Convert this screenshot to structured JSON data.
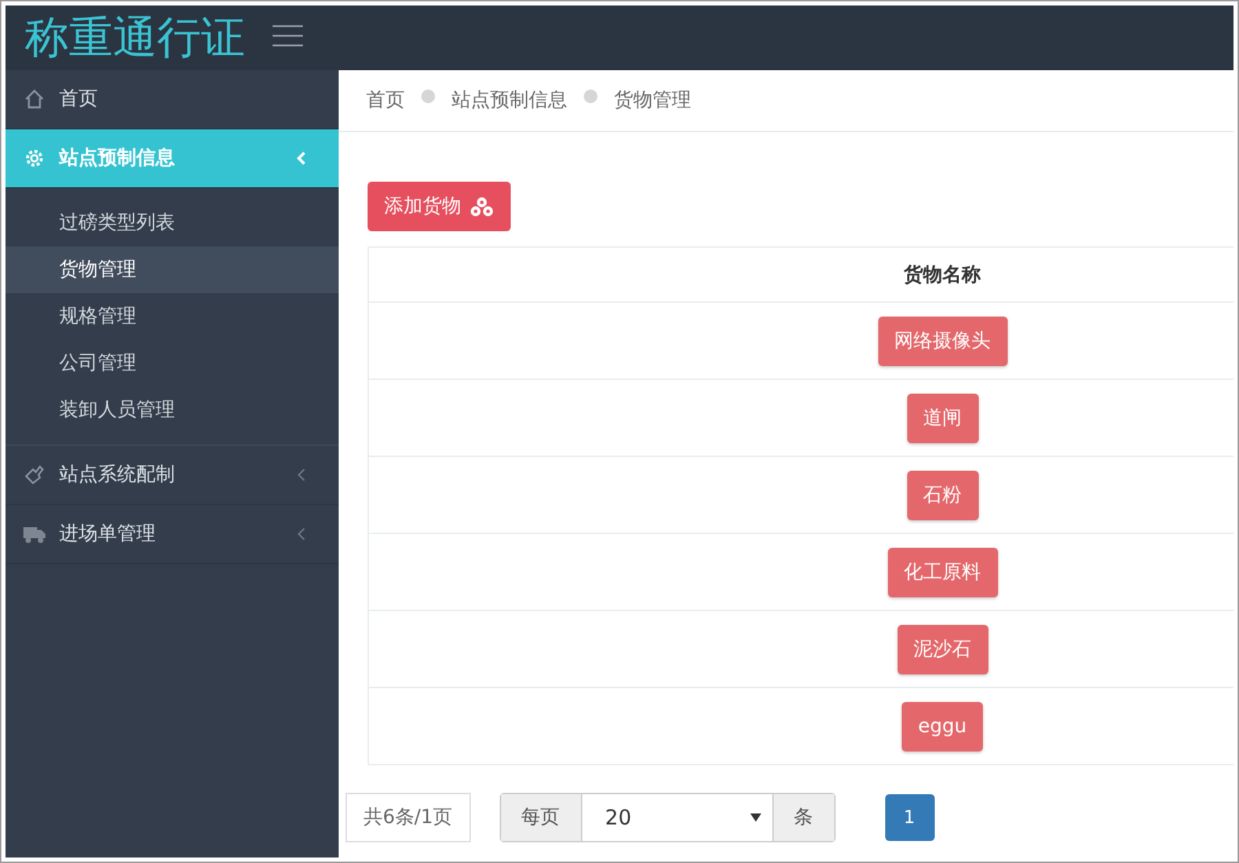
{
  "app": {
    "title": "称重通行证"
  },
  "sidebar": {
    "items": [
      {
        "label": "首页",
        "selected": false
      },
      {
        "label": "站点预制信息",
        "selected": true,
        "expanded": true,
        "children": [
          {
            "label": "过磅类型列表",
            "selected": false
          },
          {
            "label": "货物管理",
            "selected": true
          },
          {
            "label": "规格管理",
            "selected": false
          },
          {
            "label": "公司管理",
            "selected": false
          },
          {
            "label": "装卸人员管理",
            "selected": false
          }
        ]
      },
      {
        "label": "站点系统配制",
        "selected": false,
        "expanded": false
      },
      {
        "label": "进场单管理",
        "selected": false,
        "expanded": false
      }
    ]
  },
  "breadcrumb": [
    "首页",
    "站点预制信息",
    "货物管理"
  ],
  "add_button": "添加货物",
  "table": {
    "columns": [
      "货物名称"
    ],
    "rows": [
      [
        "网络摄像头"
      ],
      [
        "道闸"
      ],
      [
        "石粉"
      ],
      [
        "化工原料"
      ],
      [
        "泥沙石"
      ],
      [
        "eggu"
      ]
    ]
  },
  "pagination": {
    "summary": "共6条/1页",
    "per_page_label": "每页",
    "per_page": "20",
    "unit": "条",
    "pages": [
      {
        "label": "1",
        "selected": true
      }
    ]
  }
}
